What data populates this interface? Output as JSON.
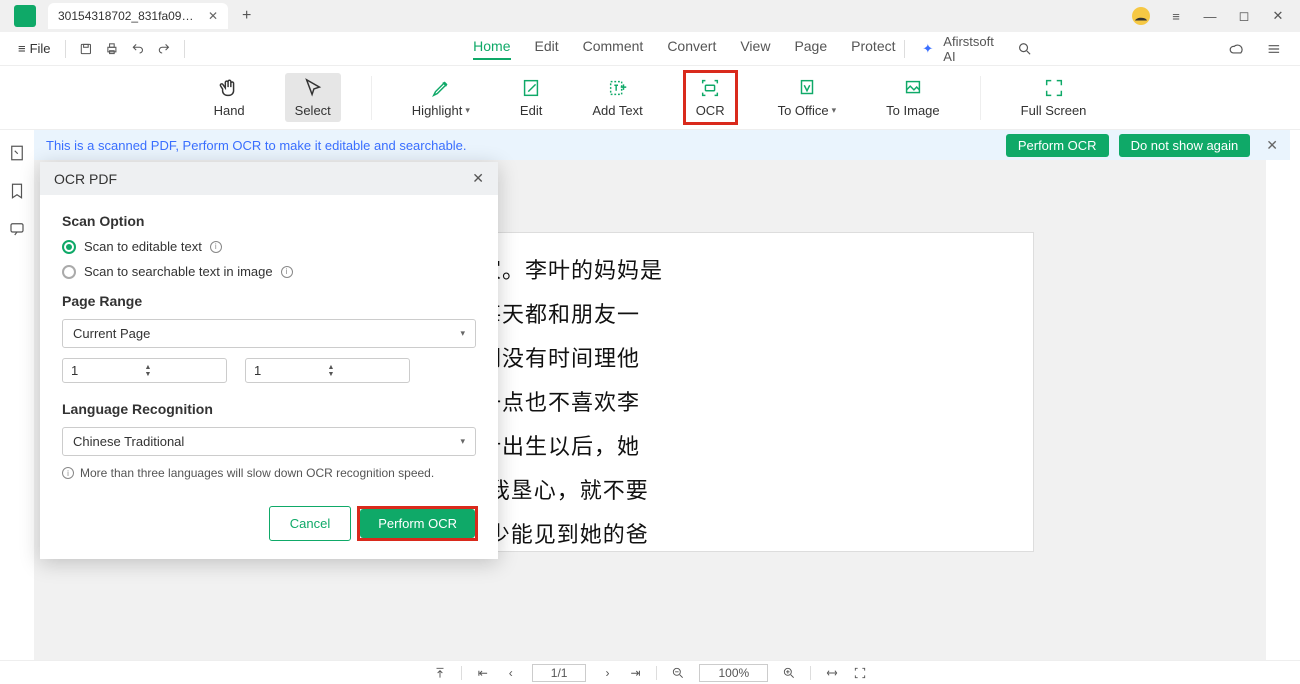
{
  "titlebar": {
    "tab_name": "30154318702_831fa09e2..."
  },
  "menubar": {
    "file": "File",
    "tabs": [
      "Home",
      "Edit",
      "Comment",
      "Convert",
      "View",
      "Page",
      "Protect"
    ],
    "ai": "Afirstsoft AI"
  },
  "ribbon": {
    "hand": "Hand",
    "select": "Select",
    "highlight": "Highlight",
    "edit": "Edit",
    "addtext": "Add Text",
    "ocr": "OCR",
    "tooffice": "To Office",
    "toimage": "To Image",
    "fullscreen": "Full Screen"
  },
  "banner": {
    "msg": "This is a scanned PDF, Perform OCR to make it editable and searchable.",
    "perform": "Perform OCR",
    "hide": "Do not show again"
  },
  "dialog": {
    "title": "OCR PDF",
    "scan_option": "Scan Option",
    "opt1": "Scan to editable text",
    "opt2": "Scan to searchable text in image",
    "page_range": "Page Range",
    "range_sel": "Current Page",
    "from": "1",
    "to": "1",
    "lang_title": "Language Recognition",
    "lang_val": "Chinese Traditional",
    "hint": "More than three languages will slow down OCR recognition speed.",
    "cancel": "Cancel",
    "perform": "Perform OCR"
  },
  "document": {
    "l1": "了在外面，很少在家。李叶的妈妈是",
    "l2": "，她有很多朋友，每天都和朋友一",
    "l3": "爸妈妈都很羡，他们没有时间理他",
    "l4": "，李叶的妈妈好像一点也不喜欢李",
    "l5": "一点也不详她。李叶出生以后，她",
    "l6": "姨：\"如果你们想让我垦心，就不要",
    "l7": "子。\"所以，李叶很少能见到她的爸"
  },
  "status": {
    "page": "1/1",
    "zoom": "100%"
  }
}
